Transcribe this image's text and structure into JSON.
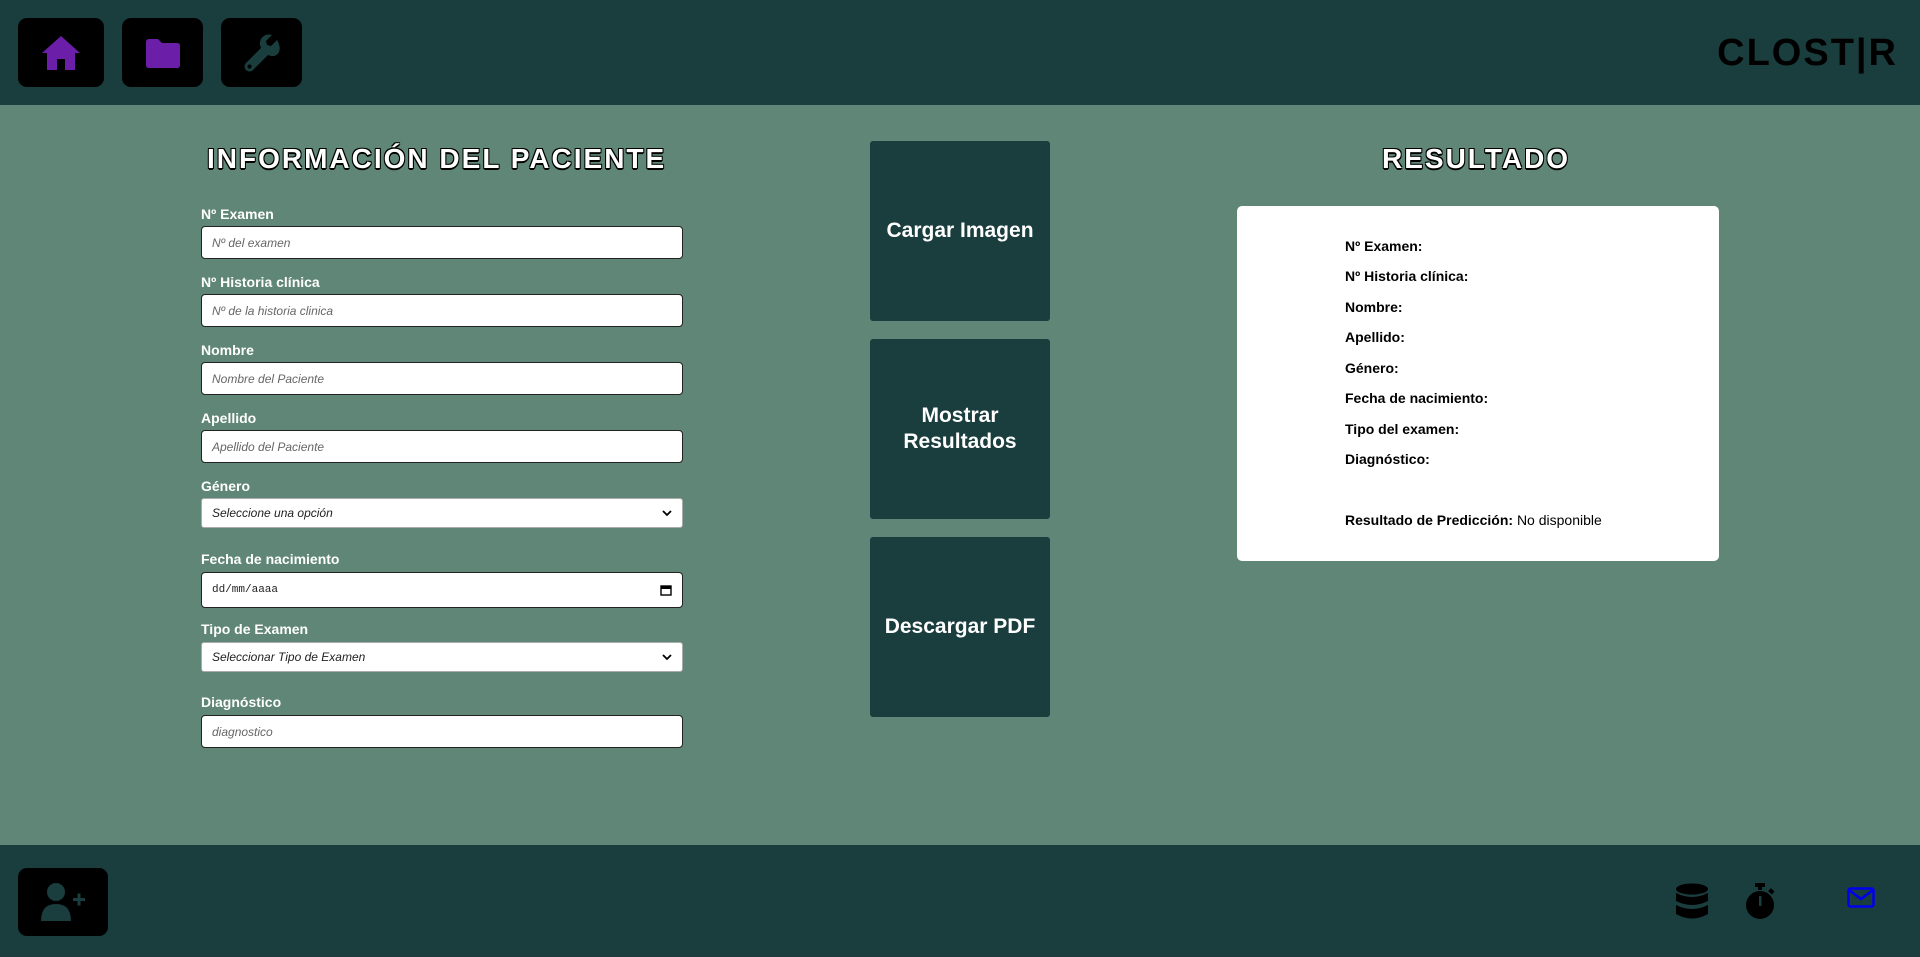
{
  "header": {
    "brand": "CLOST|R",
    "nav": [
      {
        "icon": "home-icon"
      },
      {
        "icon": "folder-icon"
      },
      {
        "icon": "wrench-icon"
      }
    ]
  },
  "form": {
    "title": "INFORMACIÓN DEL PACIENTE",
    "exam_number": {
      "label": "Nº Examen",
      "placeholder": "Nº del examen"
    },
    "history_number": {
      "label": "Nº Historia clínica",
      "placeholder": "Nº de la historia clinica"
    },
    "first_name": {
      "label": "Nombre",
      "placeholder": "Nombre del Paciente"
    },
    "last_name": {
      "label": "Apellido",
      "placeholder": "Apellido del Paciente"
    },
    "gender": {
      "label": "Género",
      "selected": "Seleccione una opción"
    },
    "birth_date": {
      "label": "Fecha de nacimiento",
      "value": "dd/mm/aaaa"
    },
    "exam_type": {
      "label": "Tipo de Examen",
      "selected": "Seleccionar Tipo de Examen"
    },
    "diagnosis": {
      "label": "Diagnóstico",
      "placeholder": "diagnostico"
    }
  },
  "actions": {
    "load_image": "Cargar Imagen",
    "show_results": "Mostrar Resultados",
    "download_pdf": "Descargar PDF"
  },
  "result": {
    "title": "RESULTADO",
    "exam_number": "Nº Examen:",
    "history_number": "Nº Historia clínica:",
    "first_name": "Nombre:",
    "last_name": "Apellido:",
    "gender": "Género:",
    "birth_date": "Fecha de nacimiento:",
    "exam_type": "Tipo del examen:",
    "diagnosis": "Diagnóstico:",
    "prediction_label": "Resultado de Predicción:",
    "prediction_value": "No disponible"
  },
  "footer": {
    "icons": [
      "add-user-icon",
      "database-icon",
      "stopwatch-icon",
      "mail-icon"
    ]
  },
  "colors": {
    "background": "#5f8676",
    "bar": "#1a3d3e",
    "nav_icon": "#6b1fa8",
    "mail_icon": "#0000ee"
  }
}
